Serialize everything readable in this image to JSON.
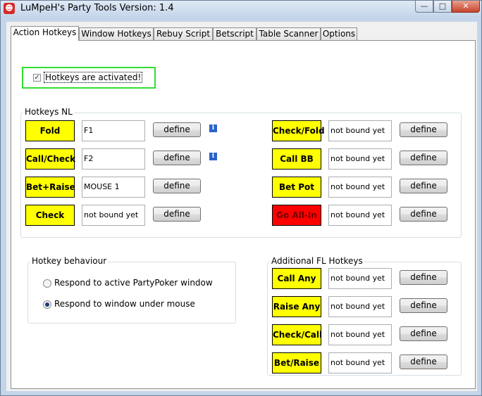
{
  "window": {
    "title": "LuMpeH's Party Tools   Version: 1.4",
    "app_icon": "smiley-icon",
    "controls": {
      "minimize": "—",
      "maximize": "□",
      "close": "✕"
    }
  },
  "tabs": [
    {
      "label": "Action Hotkeys",
      "active": true
    },
    {
      "label": "Window Hotkeys"
    },
    {
      "label": "Rebuy Script"
    },
    {
      "label": "Betscript"
    },
    {
      "label": "Table Scanner"
    },
    {
      "label": "Options"
    }
  ],
  "activation": {
    "checked": true,
    "check_mark": "✓",
    "label": "Hotkeys are activated!"
  },
  "colors": {
    "action_yellow": "#ffff00",
    "action_red": "#ff0000",
    "highlight_green": "#33dd33"
  },
  "hotkeys_nl": {
    "title": "Hotkeys NL",
    "define_label": "define",
    "info_glyph": "i",
    "left": [
      {
        "action": "Fold",
        "binding": "F1",
        "info": true
      },
      {
        "action": "Call/Check",
        "binding": "F2",
        "info": true
      },
      {
        "action": "Bet+Raise",
        "binding": "MOUSE 1"
      },
      {
        "action": "Check",
        "binding": "not bound yet"
      }
    ],
    "right": [
      {
        "action": "Check/Fold",
        "binding": "not bound yet"
      },
      {
        "action": "Call BB",
        "binding": "not bound yet"
      },
      {
        "action": "Bet Pot",
        "binding": "not bound yet"
      },
      {
        "action": "Go All-In",
        "binding": "not bound yet",
        "color": "red"
      }
    ]
  },
  "behaviour": {
    "title": "Hotkey behaviour",
    "options": [
      {
        "label": "Respond to active PartyPoker window",
        "selected": false
      },
      {
        "label": "Respond to window under mouse",
        "selected": true
      }
    ]
  },
  "fl_hotkeys": {
    "title": "Additional FL Hotkeys",
    "define_label": "define",
    "items": [
      {
        "action": "Call Any",
        "binding": "not bound yet"
      },
      {
        "action": "Raise Any",
        "binding": "not bound yet"
      },
      {
        "action": "Check/Call",
        "binding": "not bound yet"
      },
      {
        "action": "Bet/Raise",
        "binding": "not bound yet"
      }
    ]
  }
}
